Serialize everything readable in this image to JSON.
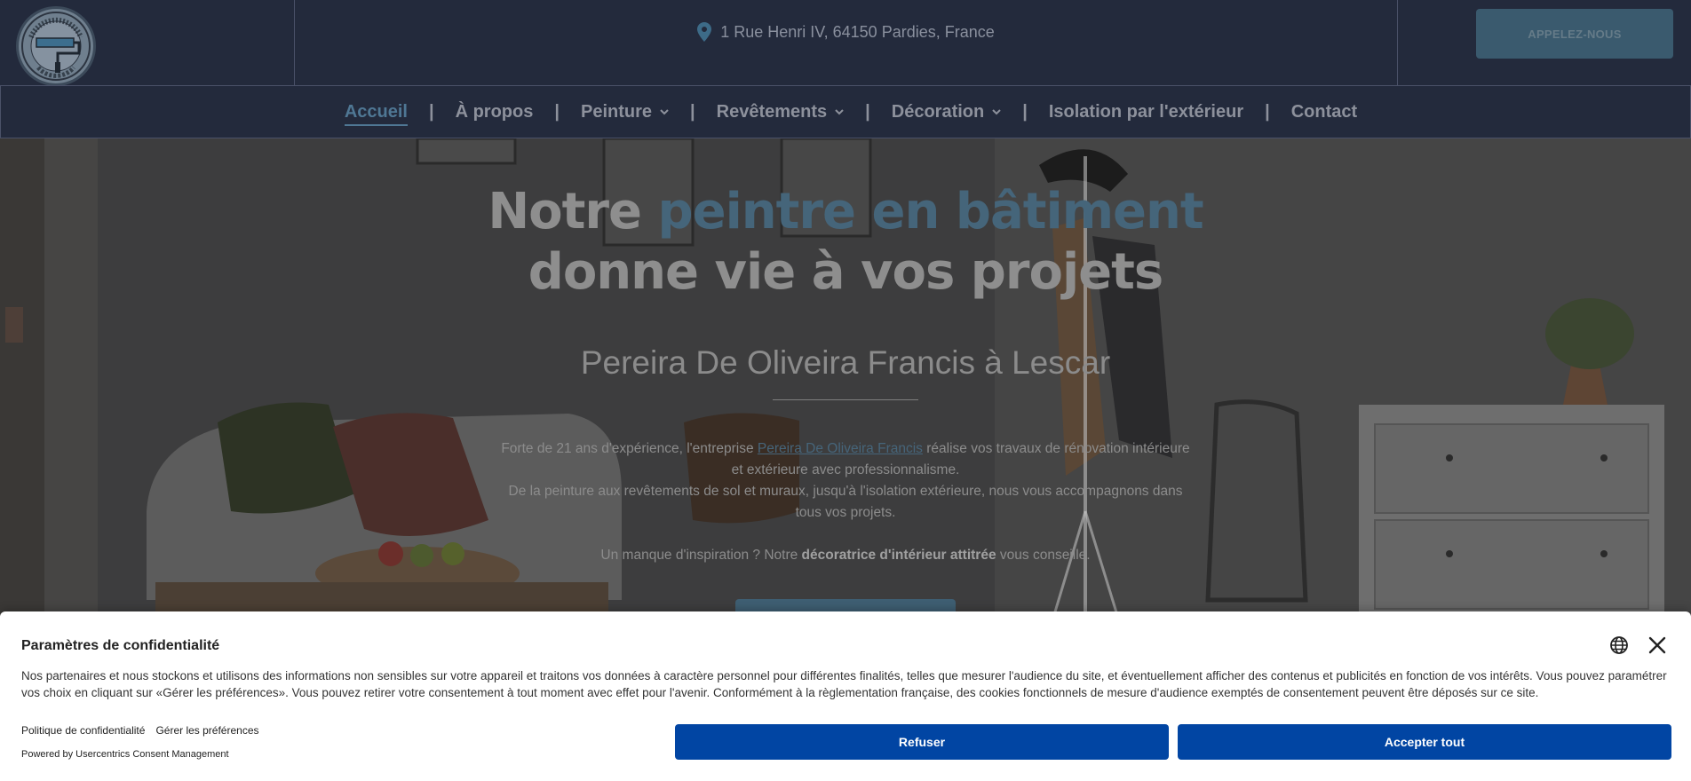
{
  "header": {
    "logo_alt": "PEREIRADEOLIVEIRA FRANCIS",
    "address": "1 Rue Henri IV, 64150 Pardies, France",
    "call_button": "APPELEZ-NOUS"
  },
  "nav": {
    "items": [
      {
        "label": "Accueil",
        "active": true
      },
      {
        "label": "À propos"
      },
      {
        "label": "Peinture",
        "dropdown": true
      },
      {
        "label": "Revêtements",
        "dropdown": true
      },
      {
        "label": "Décoration",
        "dropdown": true
      },
      {
        "label": "Isolation par l'extérieur"
      },
      {
        "label": "Contact"
      }
    ],
    "separator": "|"
  },
  "hero": {
    "title_part1": "Notre ",
    "title_highlight": "peintre en bâtiment",
    "title_line2": "donne vie à vos projets",
    "subtitle": "Pereira De Oliveira Francis à Lescar",
    "para1_before": "Forte de 21 ans d'expérience, l'entreprise ",
    "para1_link": "Pereira De Oliveira Francis",
    "para1_after": " réalise vos travaux de rénovation intérieure et extérieure avec professionnalisme.",
    "para2": "De la peinture aux revêtements de sol et muraux, jusqu'à l'isolation extérieure, nous vous accompagnons dans tous vos projets.",
    "para3_before": "Un manque d'inspiration ? Notre ",
    "para3_bold": "décoratrice d'intérieur attitrée",
    "para3_after": " vous conseille."
  },
  "consent": {
    "title": "Paramètres de confidentialité",
    "text": "Nos partenaires et nous stockons et utilisons des informations non sensibles sur votre appareil et traitons vos données à caractère personnel pour différentes finalités, telles que mesurer l'audience du site, et éventuellement afficher des contenus et publicités en fonction de vos intérêts. Vous pouvez paramétrer vos choix en cliquant sur «Gérer les préférences». Vous pouvez retirer votre consentement à tout moment avec effet pour l'avenir. Conformément à la règlementation française, des cookies fonctionnels de mesure d'audience exemptés de consentement peuvent être déposés sur ce site.",
    "link_privacy": "Politique de confidentialité",
    "link_prefs": "Gérer les préférences",
    "powered": "Powered by Usercentrics Consent Management",
    "refuse": "Refuser",
    "accept": "Accepter tout",
    "icons": [
      "globe-icon",
      "close-icon"
    ]
  },
  "colors": {
    "accent_blue": "#0145a3",
    "nav_active": "#4f7794",
    "header_bg": "#232a3c"
  }
}
